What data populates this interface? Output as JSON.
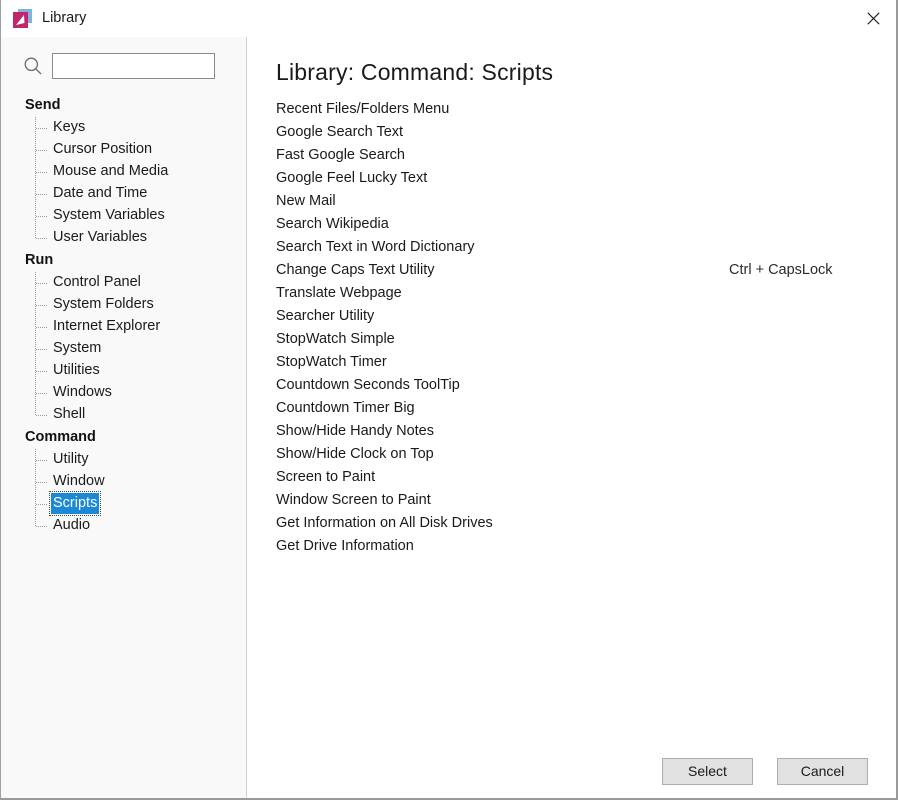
{
  "window": {
    "title": "Library",
    "app_icon": "library-app-icon",
    "close_label": "×"
  },
  "sidebar": {
    "search": {
      "icon": "search-icon",
      "value": "",
      "placeholder": ""
    },
    "groups": [
      {
        "label": "Send",
        "items": [
          "Keys",
          "Cursor Position",
          "Mouse and Media",
          "Date and Time",
          "System Variables",
          "User Variables"
        ]
      },
      {
        "label": "Run",
        "items": [
          "Control Panel",
          "System Folders",
          "Internet Explorer",
          "System",
          "Utilities",
          "Windows",
          "Shell"
        ]
      },
      {
        "label": "Command",
        "items": [
          "Utility",
          "Window",
          "Scripts",
          "Audio"
        ]
      }
    ],
    "selected_item": "Scripts",
    "selection_color": "#1b8ad6"
  },
  "main": {
    "title": "Library:  Command:  Scripts",
    "scripts": [
      {
        "name": "Recent Files/Folders Menu",
        "shortcut": ""
      },
      {
        "name": "Google Search Text",
        "shortcut": ""
      },
      {
        "name": "Fast Google Search",
        "shortcut": ""
      },
      {
        "name": "Google Feel Lucky Text",
        "shortcut": ""
      },
      {
        "name": "New Mail",
        "shortcut": ""
      },
      {
        "name": "Search Wikipedia",
        "shortcut": ""
      },
      {
        "name": "Search Text in Word Dictionary",
        "shortcut": ""
      },
      {
        "name": "Change Caps Text Utility",
        "shortcut": "Ctrl + CapsLock"
      },
      {
        "name": "Translate Webpage",
        "shortcut": ""
      },
      {
        "name": "Searcher Utility",
        "shortcut": ""
      },
      {
        "name": "StopWatch Simple",
        "shortcut": ""
      },
      {
        "name": "StopWatch Timer",
        "shortcut": ""
      },
      {
        "name": "Countdown Seconds ToolTip",
        "shortcut": ""
      },
      {
        "name": "Countdown Timer Big",
        "shortcut": ""
      },
      {
        "name": "Show/Hide Handy Notes",
        "shortcut": ""
      },
      {
        "name": "Show/Hide Clock on Top",
        "shortcut": ""
      },
      {
        "name": "Screen to Paint",
        "shortcut": ""
      },
      {
        "name": "Window Screen to Paint",
        "shortcut": ""
      },
      {
        "name": "Get Information on All Disk Drives",
        "shortcut": ""
      },
      {
        "name": "Get Drive Information",
        "shortcut": ""
      }
    ]
  },
  "footer": {
    "select_label": "Select",
    "cancel_label": "Cancel"
  }
}
